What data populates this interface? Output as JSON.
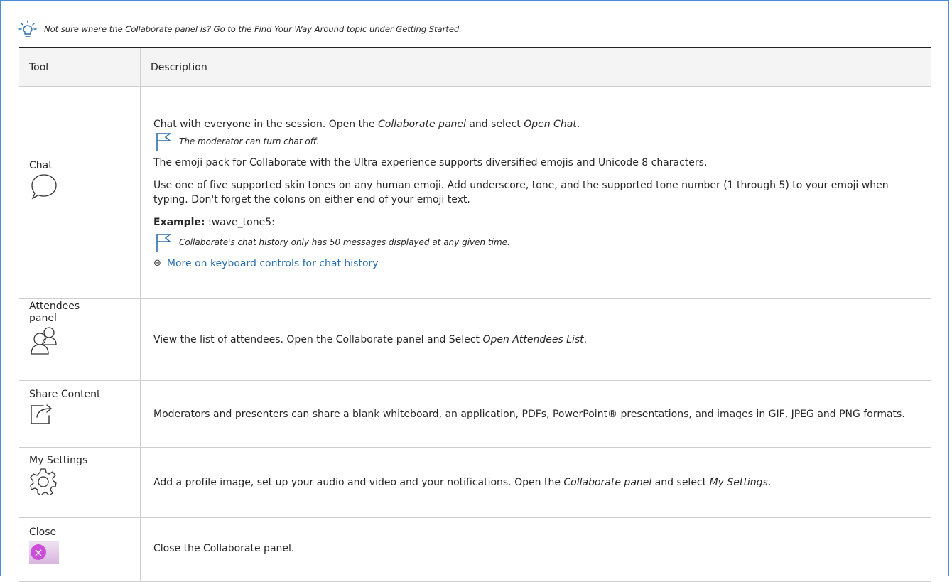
{
  "tip": {
    "text": "Not sure where the Collaborate panel is? Go to the Find Your Way Around topic under Getting Started.",
    "icon": "lightbulb-icon"
  },
  "table": {
    "headers": {
      "tool": "Tool",
      "description": "Description"
    },
    "rows": {
      "chat": {
        "tool": "Chat",
        "icon": "chat-bubble-icon",
        "intro": "Chat with everyone in the session. Open the ",
        "intro_em1": "Collaborate panel",
        "intro_mid": " and select ",
        "intro_em2": "Open Chat",
        "intro_end": ".",
        "note1": "The moderator can turn chat off.",
        "emoji_pack": "The emoji pack for Collaborate with the Ultra experience supports diversified emojis and Unicode 8 characters.",
        "skin_tones": "Use one of five supported skin tones on any human emoji. Add underscore, tone, and the supported tone number (1 through 5) to your emoji when typing. Don't forget the colons on either end of your emoji text.",
        "example_label": "Example:",
        "example_value": " :wave_tone5:",
        "note2": "Collaborate's chat history only has 50 messages displayed at any given time.",
        "link_text": "More on keyboard controls for chat history",
        "link_glyph": "⊖"
      },
      "attendees": {
        "tool": "Attendees panel",
        "icon": "attendees-icon",
        "desc_start": "View the list of attendees. Open the Collaborate panel and Select ",
        "desc_em": "Open Attendees List",
        "desc_end": "."
      },
      "share": {
        "tool": "Share Content",
        "icon": "share-content-icon",
        "desc": "Moderators and presenters can share a blank whiteboard, an application, PDFs, PowerPoint® presentations, and images in GIF, JPEG and PNG formats."
      },
      "settings": {
        "tool": "My Settings",
        "icon": "gear-icon",
        "desc_start": "Add a profile image, set up your audio and video and your notifications. Open the ",
        "desc_em1": "Collaborate panel",
        "desc_mid": " and select ",
        "desc_em2": "My Settings",
        "desc_end": "."
      },
      "close": {
        "tool": "Close",
        "icon": "close-icon",
        "icon_glyph": "×",
        "desc": "Close the Collaborate panel."
      }
    }
  },
  "colors": {
    "frame_border": "#4a8ed4",
    "flag_icon": "#2a6fad",
    "link": "#2a6fad",
    "close_button": "#c94fd6"
  }
}
